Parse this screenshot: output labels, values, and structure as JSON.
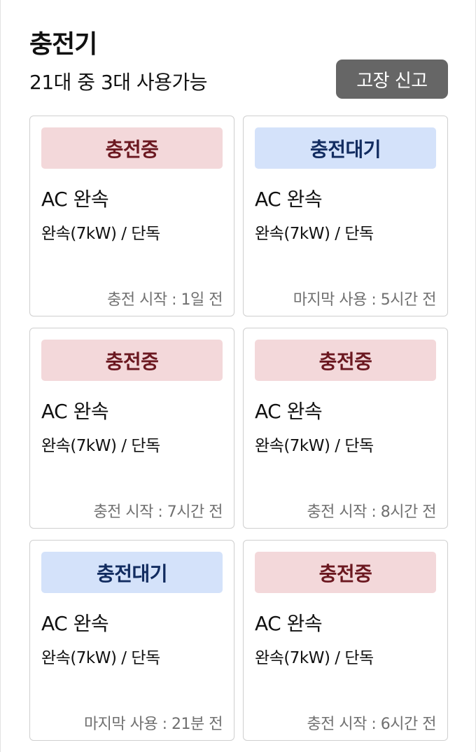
{
  "header": {
    "title": "충전기",
    "availability": "21대 중 3대 사용가능",
    "report_button": "고장 신고"
  },
  "colors": {
    "charging_bg": "#f3d8da",
    "charging_text": "#6b1820",
    "waiting_bg": "#d4e2fa",
    "waiting_text": "#122c60",
    "button_bg": "#666666"
  },
  "chargers": [
    {
      "status": "충전중",
      "status_kind": "charging",
      "type": "AC 완속",
      "spec": "완속(7kW) / 단독",
      "time_info": "충전 시작 : 1일 전"
    },
    {
      "status": "충전대기",
      "status_kind": "waiting",
      "type": "AC 완속",
      "spec": "완속(7kW) / 단독",
      "time_info": "마지막 사용 : 5시간 전"
    },
    {
      "status": "충전중",
      "status_kind": "charging",
      "type": "AC 완속",
      "spec": "완속(7kW) / 단독",
      "time_info": "충전 시작 : 7시간 전"
    },
    {
      "status": "충전중",
      "status_kind": "charging",
      "type": "AC 완속",
      "spec": "완속(7kW) / 단독",
      "time_info": "충전 시작 : 8시간 전"
    },
    {
      "status": "충전대기",
      "status_kind": "waiting",
      "type": "AC 완속",
      "spec": "완속(7kW) / 단독",
      "time_info": "마지막 사용 : 21분 전"
    },
    {
      "status": "충전중",
      "status_kind": "charging",
      "type": "AC 완속",
      "spec": "완속(7kW) / 단독",
      "time_info": "충전 시작 : 6시간 전"
    }
  ]
}
